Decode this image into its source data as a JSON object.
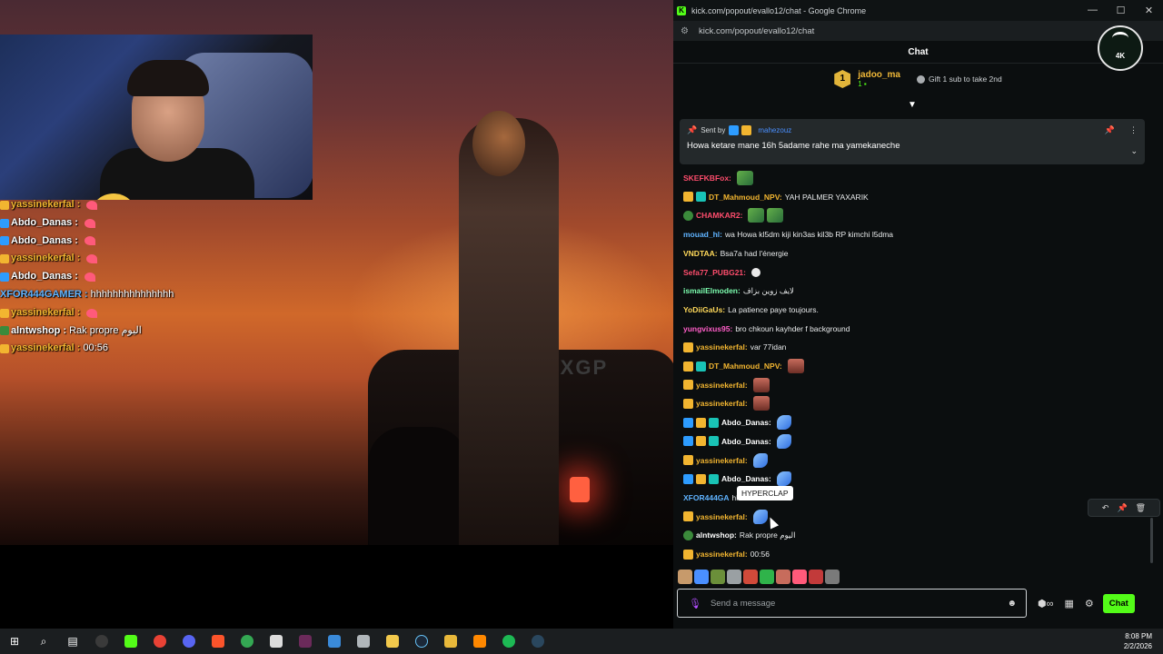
{
  "window": {
    "title": "kick.com/popout/evallo12/chat - Google Chrome",
    "url": "kick.com/popout/evallo12/chat",
    "controls": [
      "—",
      "☐",
      "✕"
    ]
  },
  "chat": {
    "header": "Chat",
    "team_logo_text": "4K",
    "leaderboard": {
      "rank": "1",
      "name": "jadoo_ma",
      "count": "1 ▪",
      "gift_text": "Gift 1 sub to take 2nd"
    },
    "pinned": {
      "sent_by_label": "Sent by",
      "name": "mahezouz",
      "message": "Howa ketare mane 16h 5adame rahe ma yamekaneche"
    },
    "tooltip": "HYPERCLAP",
    "input": {
      "placeholder": "Send a message",
      "send_label": "Chat"
    },
    "messages": [
      {
        "name": "SKEFKBFox:",
        "text": "",
        "color": "#ff4d6d"
      },
      {
        "name": "DT_Mahmoud_NPV:",
        "text": "YAH PALMER YAXARIK",
        "color": "#f2b530"
      },
      {
        "name": "CHAMKAR2:",
        "text": "",
        "color": "#ff4d6d"
      },
      {
        "name": "mouad_hl:",
        "text": "wa Howa kl5dm kiji kin3as kil3b RP kimchi l5dma",
        "color": "#5fb3ff"
      },
      {
        "name": "VNDTAA:",
        "text": "Bsa7a had l'énergie",
        "color": "#ffd95a"
      },
      {
        "name": "Sefa77_PUBG21:",
        "text": "",
        "color": "#ff4d6d"
      },
      {
        "name": "ismailElmoden:",
        "text": "لايف زوين بزاف",
        "color": "#7dffb0"
      },
      {
        "name": "YoDiiGaUs:",
        "text": "La patience paye toujours.",
        "color": "#ffd95a"
      },
      {
        "name": "yungvixus95:",
        "text": "bro chkoun kayhder f background",
        "color": "#ff5ec8"
      },
      {
        "name": "yassinekerfal:",
        "text": "var 77idan",
        "color": "#f2b530"
      },
      {
        "name": "DT_Mahmoud_NPV:",
        "text": "",
        "color": "#f2b530"
      },
      {
        "name": "yassinekerfal:",
        "text": "",
        "color": "#f2b530"
      },
      {
        "name": "yassinekerfal:",
        "text": "",
        "color": "#f2b530"
      },
      {
        "name": "Abdo_Danas:",
        "text": "",
        "color": "#ffffff"
      },
      {
        "name": "Abdo_Danas:",
        "text": "",
        "color": "#ffffff"
      },
      {
        "name": "yassinekerfal:",
        "text": "",
        "color": "#f2b530"
      },
      {
        "name": "Abdo_Danas:",
        "text": "",
        "color": "#ffffff"
      },
      {
        "name": "XFOR444GA",
        "text": "hhhhhhhhh",
        "color": "#5fb3ff"
      },
      {
        "name": "yassinekerfal:",
        "text": "",
        "color": "#f2b530"
      },
      {
        "name": "alntwshop:",
        "text": "Rak propre اليوم",
        "color": "#ffffff"
      },
      {
        "name": "yassinekerfal:",
        "text": "00:56",
        "color": "#f2b530"
      }
    ]
  },
  "overlay_chat": [
    {
      "name": "yassinekerfal :",
      "text": "",
      "color": "#f2b530"
    },
    {
      "name": "Abdo_Danas :",
      "text": "",
      "color": "#ffffff"
    },
    {
      "name": "Abdo_Danas :",
      "text": "",
      "color": "#ffffff"
    },
    {
      "name": "yassinekerfal :",
      "text": "",
      "color": "#f2b530"
    },
    {
      "name": "Abdo_Danas :",
      "text": "",
      "color": "#ffffff"
    },
    {
      "name": "XFOR444GAMER :",
      "text": "hhhhhhhhhhhhhhh",
      "color": "#5fb3ff"
    },
    {
      "name": "yassinekerfal :",
      "text": "",
      "color": "#f2b530"
    },
    {
      "name": "alntwshop :",
      "text": "Rak propre اليوم",
      "color": "#ffffff"
    },
    {
      "name": "yassinekerfal :",
      "text": "00:56",
      "color": "#f2b530"
    }
  ],
  "stream": {
    "car_logo": "PXGP"
  },
  "taskbar": {
    "time": "8:08 PM",
    "date": "2/2/2026"
  },
  "colors": {
    "kick_green": "#53fc18",
    "background": "#0b0e0f"
  }
}
